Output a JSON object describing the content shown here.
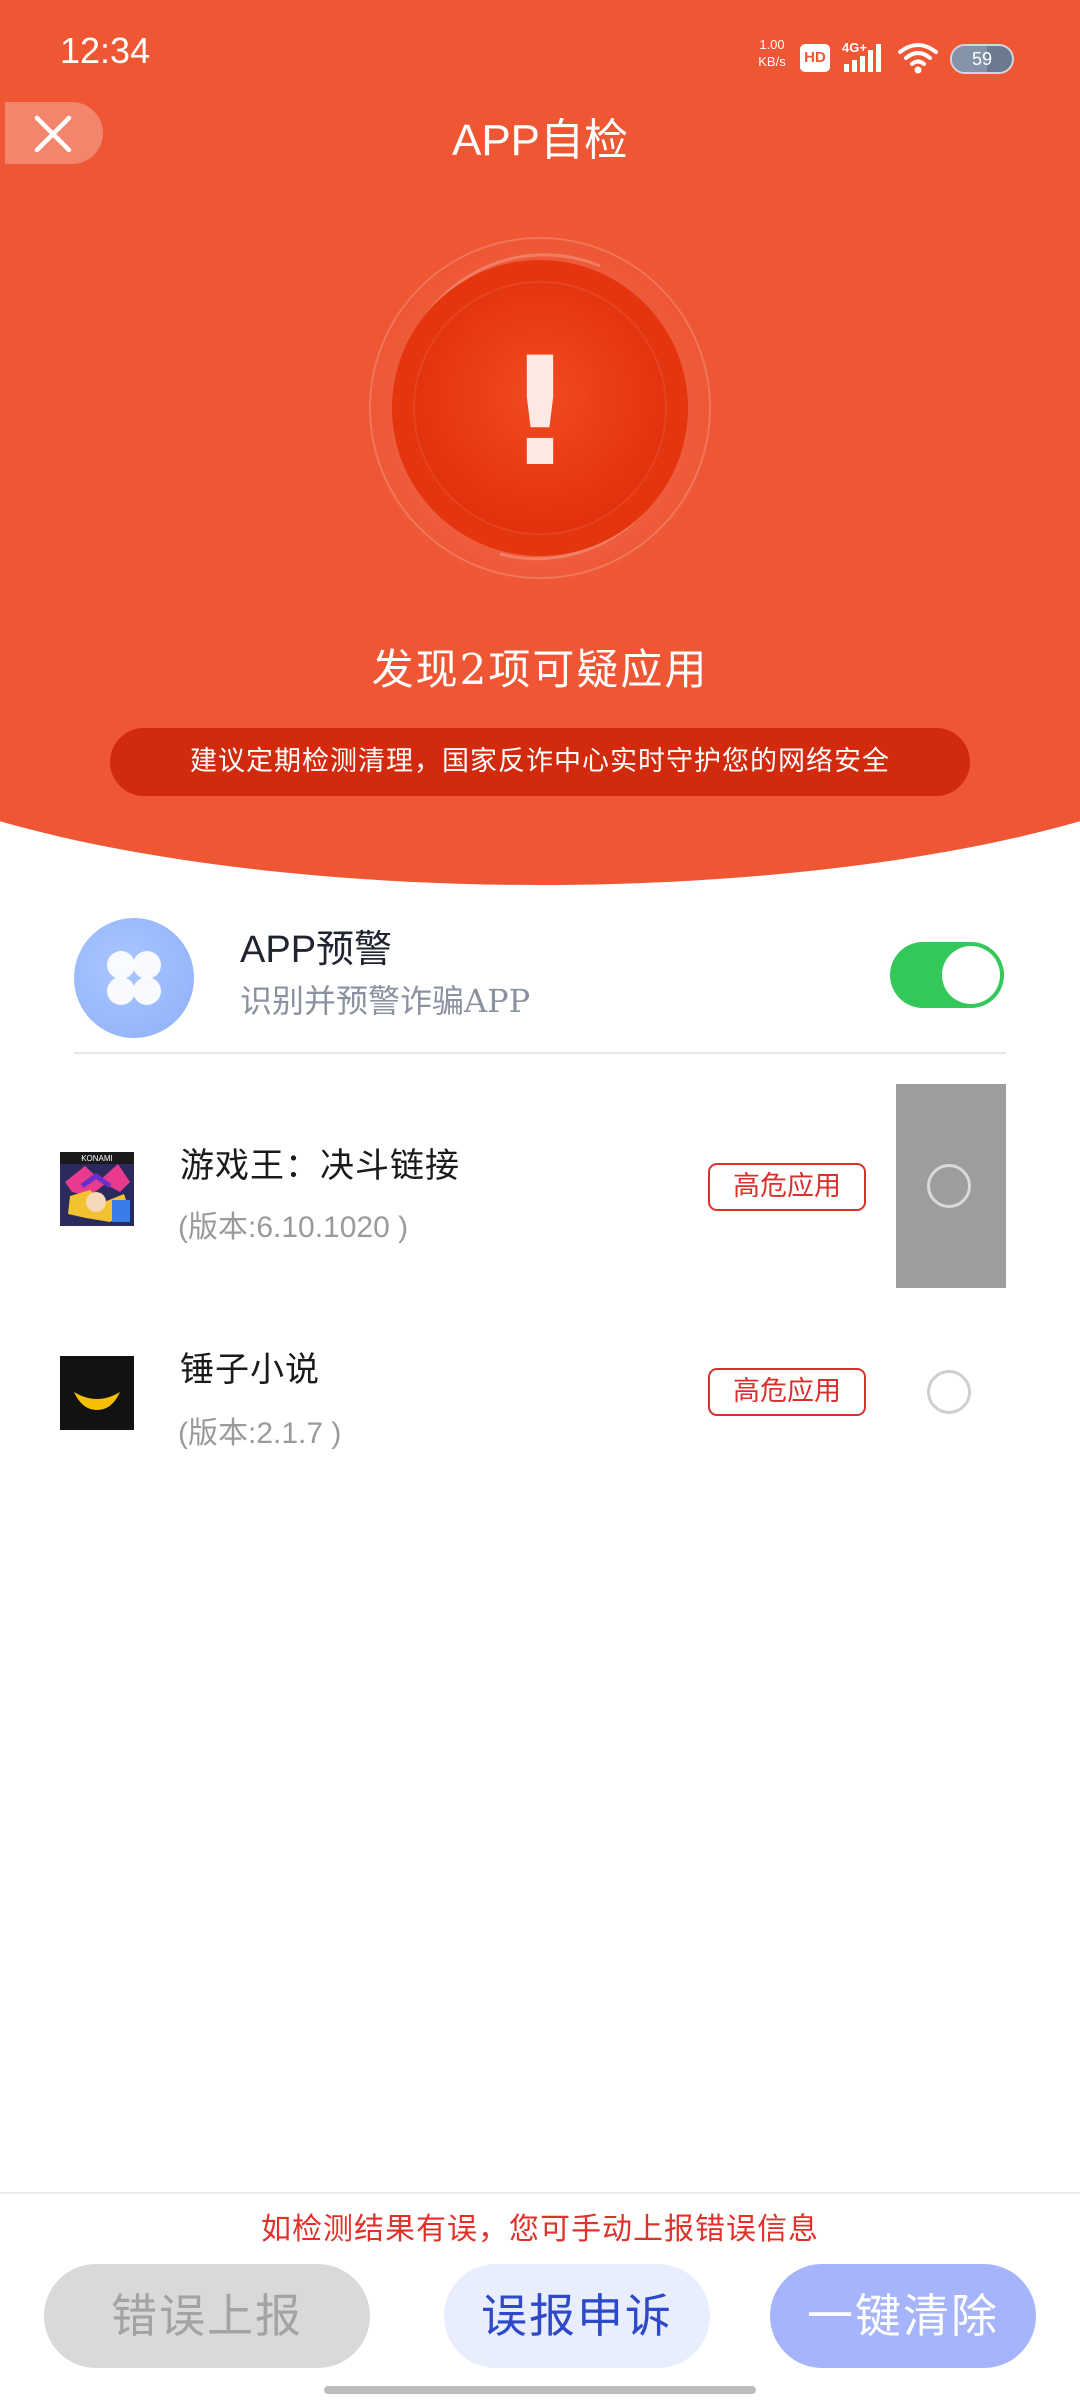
{
  "status_bar": {
    "time": "12:34",
    "net_speed_value": "1.00",
    "net_speed_unit": "KB/s",
    "hd_label": "HD",
    "network_label": "4G+",
    "battery_level": "59"
  },
  "nav": {
    "title": "APP自检"
  },
  "hero": {
    "result_title": "发现2项可疑应用",
    "advice": "建议定期检测清理，国家反诈中心实时守护您的网络安全",
    "emblem_symbol": "!"
  },
  "app_warning": {
    "title": "APP预警",
    "subtitle": "识别并预警诈骗APP",
    "enabled": true
  },
  "apps": [
    {
      "name": "游戏王：决斗链接",
      "version": "(版本:6.10.1020 )",
      "badge": "高危应用",
      "icon": "yugioh-app-icon",
      "icon_text": "KONAMI"
    },
    {
      "name": "锤子小说",
      "version": "(版本:2.1.7 )",
      "badge": "高危应用",
      "icon": "hammer-novel-app-icon"
    }
  ],
  "footer": {
    "hint": "如检测结果有误，您可手动上报错误信息",
    "report_label": "错误上报",
    "appeal_label": "误报申诉",
    "clear_label": "一键清除"
  },
  "colors": {
    "header_red": "#EE5634",
    "pill_red": "#D22A0C",
    "badge_red": "#D9302C",
    "toggle_green": "#34C759",
    "appeal_blue": "#2d49c9",
    "clear_blue": "#a6b4fb"
  }
}
